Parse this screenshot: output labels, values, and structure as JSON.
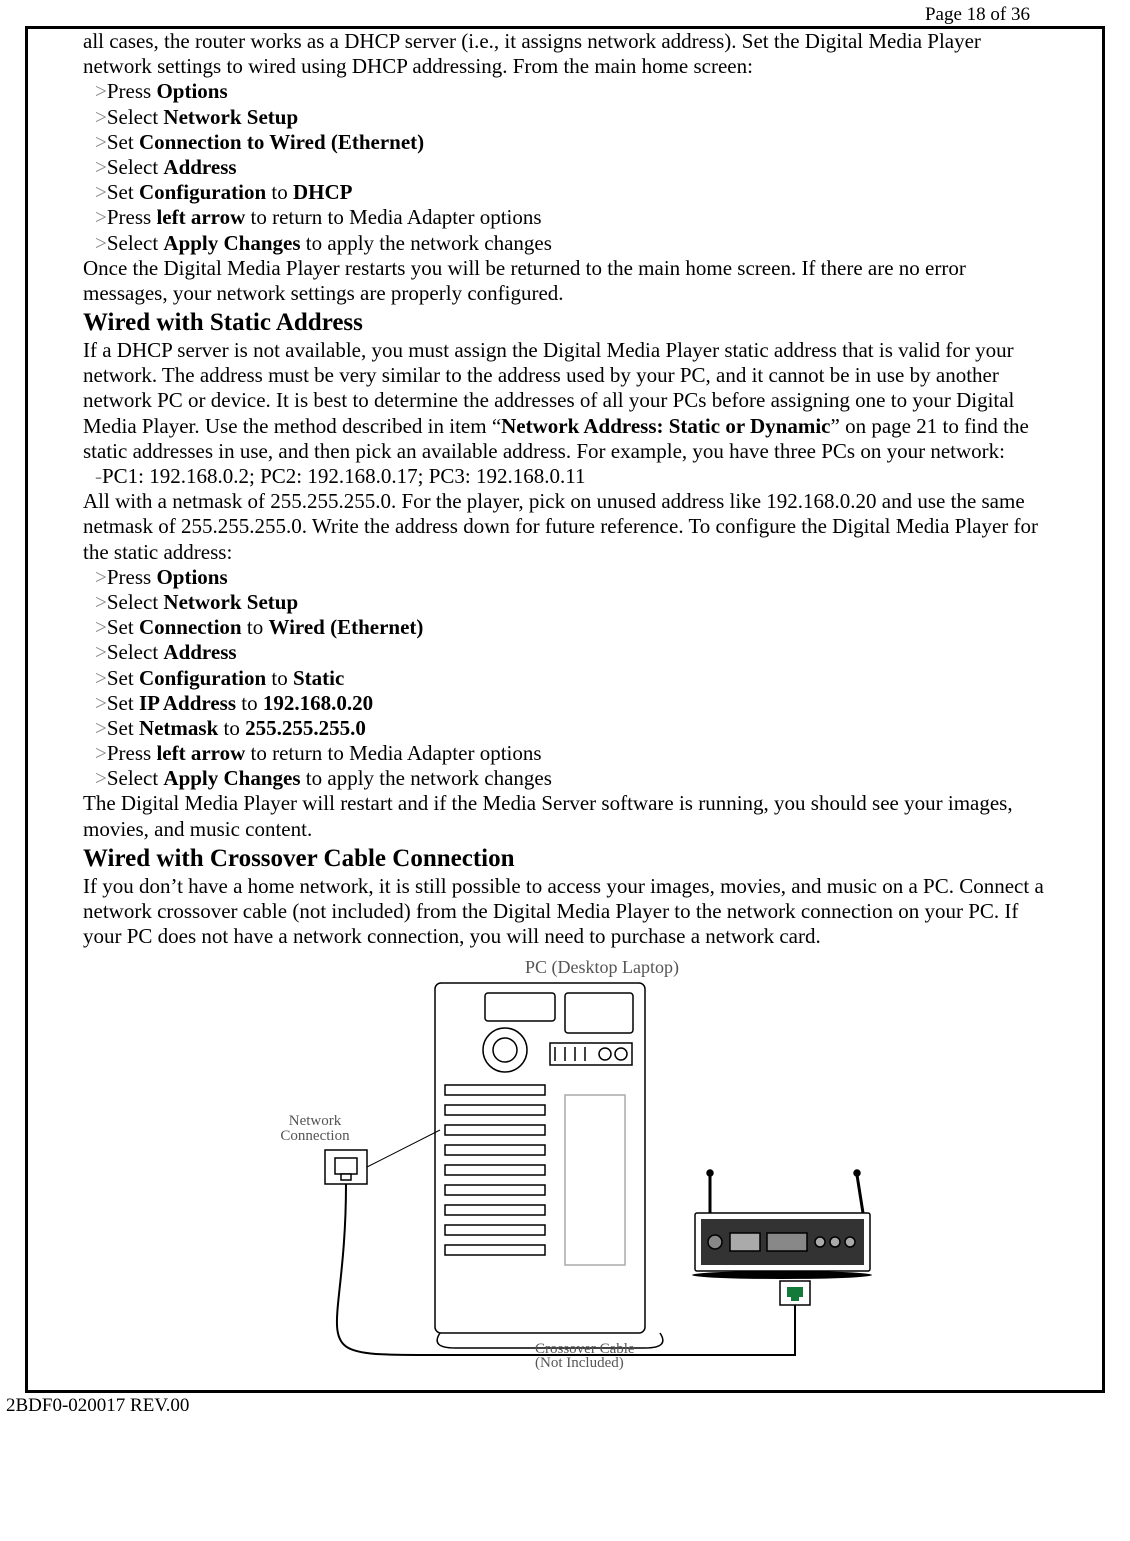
{
  "page_header": "Page 18 of 36",
  "intro": "all cases, the router works as a DHCP server (i.e., it assigns network address). Set the Digital Media Player network settings to wired using DHCP addressing. From the main home screen:",
  "steps1": [
    {
      "marker": ">",
      "pre": "Press ",
      "bold": "Options",
      "post": ""
    },
    {
      "marker": ">",
      "pre": "Select ",
      "bold": "Network Setup",
      "post": ""
    },
    {
      "marker": ">",
      "pre": "Set ",
      "bold": "Connection to Wired (Ethernet)",
      "post": ""
    },
    {
      "marker": ">",
      "pre": "Select ",
      "bold": "Address",
      "post": ""
    },
    {
      "marker": ">",
      "pre": "Set ",
      "bold": "Configuration",
      "mid": " to ",
      "bold2": "DHCP",
      "post": ""
    },
    {
      "marker": ">",
      "pre": "Press ",
      "bold": "left arrow",
      "post": " to return to Media Adapter options"
    },
    {
      "marker": ">",
      "pre": "Select ",
      "bold": "Apply Changes",
      "post": " to apply the network changes"
    }
  ],
  "after1": "Once the Digital Media Player restarts you will be returned to the main home screen. If there are no error messages, your network settings are properly configured.",
  "h2_a": "Wired with Static Address",
  "static_p1a": "If a DHCP server is not available, you must assign the Digital Media Player static address that is valid for your network. The address must be very similar to the address used by your PC, and it cannot be in use by another network PC or device. It is best to determine the addresses of all your PCs before assigning one to your Digital Media Player. Use the method described in item “",
  "static_p1b": "Network Address: Static or Dynamic",
  "static_p1c": "” on page 21 to find the static addresses in use, and then pick an available address. For example, you have three PCs on your network:",
  "pc_line": {
    "marker": "-",
    "text": "PC1: 192.168.0.2; PC2: 192.168.0.17; PC3: 192.168.0.11"
  },
  "static_p2": "All with a netmask of 255.255.255.0. For the player, pick on unused address like 192.168.0.20 and use the same netmask of 255.255.255.0. Write the address down for future reference. To configure the Digital Media Player for the static address:",
  "steps2": [
    {
      "marker": ">",
      "pre": "Press ",
      "bold": "Options",
      "post": ""
    },
    {
      "marker": ">",
      "pre": "Select ",
      "bold": "Network Setup",
      "post": ""
    },
    {
      "marker": ">",
      "pre": "Set ",
      "bold": "Connection",
      "mid": " to ",
      "bold2": "Wired (Ethernet)",
      "post": ""
    },
    {
      "marker": ">",
      "pre": "Select ",
      "bold": "Address",
      "post": ""
    },
    {
      "marker": ">",
      "pre": "Set ",
      "bold": "Configuration",
      "mid": " to ",
      "bold2": "Static",
      "post": ""
    },
    {
      "marker": ">",
      "pre": "Set ",
      "bold": "IP Address",
      "mid": " to ",
      "bold2": "192.168.0.20",
      "post": ""
    },
    {
      "marker": ">",
      "pre": "Set ",
      "bold": "Netmask",
      "mid": " to ",
      "bold2": "255.255.255.0",
      "post": ""
    },
    {
      "marker": ">",
      "pre": "Press ",
      "bold": "left arrow",
      "post": " to return to Media Adapter options"
    },
    {
      "marker": ">",
      "pre": "Select ",
      "bold": "Apply Changes",
      "post": " to apply the network changes"
    }
  ],
  "after2": "The Digital Media Player will restart and if the Media Server software is running, you should see your images, movies, and music content.",
  "h2_b": "Wired with Crossover Cable Connection",
  "cross_p": "If you don’t have a home network, it is still possible to access your images, movies, and music on a PC. Connect a network crossover cable (not included) from the Digital Media Player to the network connection on your PC. If your PC does not have a network connection, you will need to purchase a network card.",
  "fig": {
    "pc_label": "PC  (Desktop Laptop)",
    "net_label1": "Network",
    "net_label2": "Connection",
    "cable_label1": "Crossover Cable",
    "cable_label2": "(Not Included)"
  },
  "footer": "2BDF0-020017 REV.00"
}
